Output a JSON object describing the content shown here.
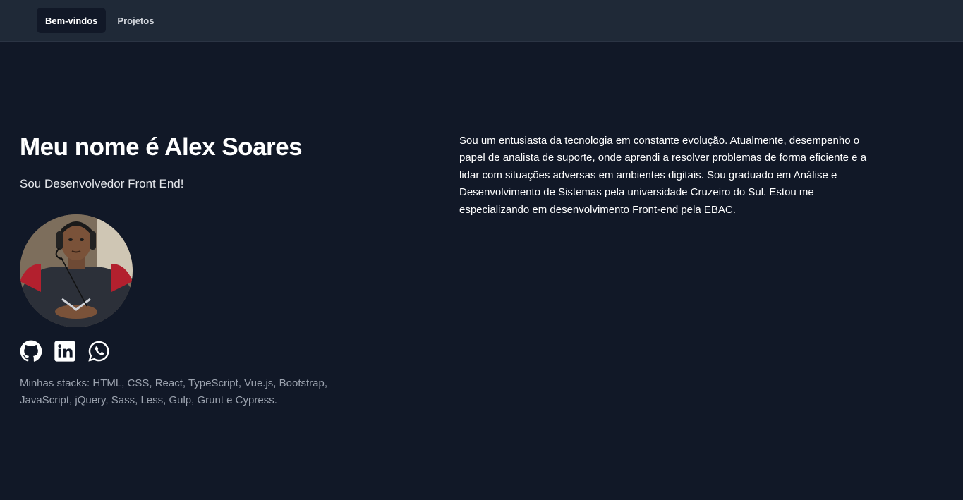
{
  "nav": {
    "items": [
      {
        "label": "Bem-vindos",
        "active": true
      },
      {
        "label": "Projetos",
        "active": false
      }
    ]
  },
  "hero": {
    "title": "Meu nome é Alex Soares",
    "subtitle": "Sou Desenvolvedor Front End!",
    "avatar_icon": "profile-photo"
  },
  "social": {
    "icons": [
      "github-icon",
      "linkedin-icon",
      "whatsapp-icon"
    ]
  },
  "stacks": "Minhas stacks: HTML, CSS, React, TypeScript, Vue.js, Bootstrap, JavaScript, jQuery, Sass, Less, Gulp, Grunt e Cypress.",
  "about": "Sou um entusiasta da tecnologia em constante evolução. Atualmente, desempenho o papel de analista de suporte, onde aprendi a resolver problemas de forma eficiente e a lidar com situações adversas em ambientes digitais. Sou graduado em Análise e Desenvolvimento de Sistemas pela universidade Cruzeiro do Sul. Estou me especializando em desenvolvimento Front-end pela EBAC.",
  "colors": {
    "background": "#111827",
    "navbar": "#1f2937",
    "active_tab": "#111827",
    "muted_text": "#9ca3af"
  }
}
